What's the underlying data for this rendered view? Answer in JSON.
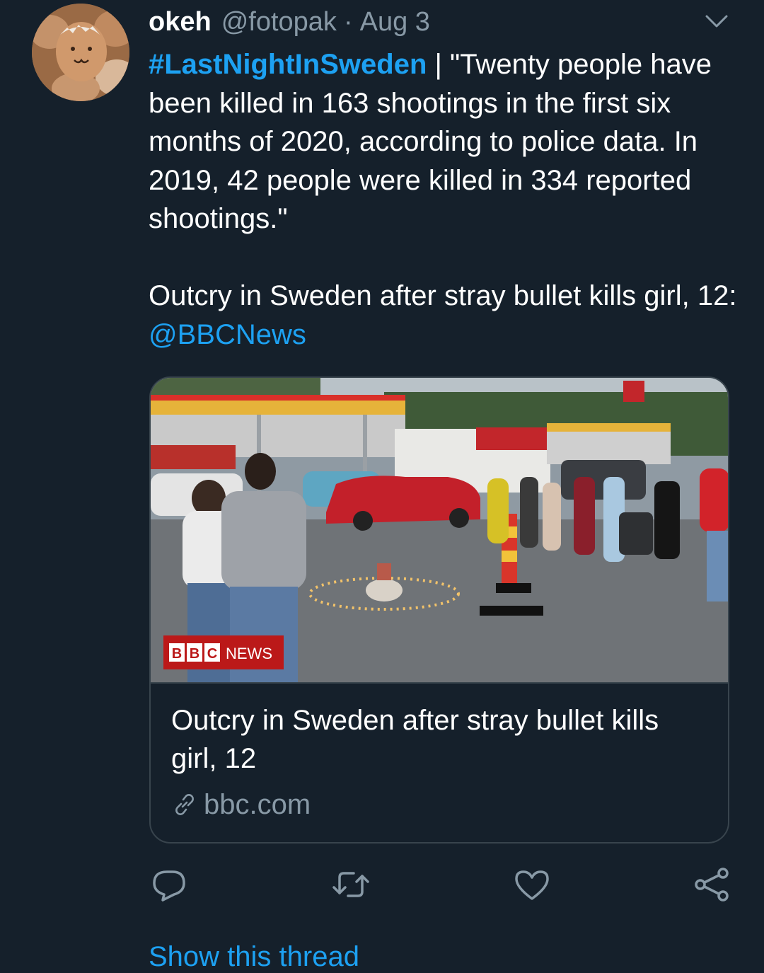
{
  "tweet": {
    "display_name": "okeh",
    "handle": "@fotopak",
    "separator": "·",
    "date": "Aug 3",
    "hashtag": "#LastNightInSweden",
    "text_part1": " | \"Twenty people have been killed in 163 shootings in the first six months of 2020, according to police data. In 2019, 42 people were killed in 334 reported shootings.\"",
    "text_part2": "Outcry in Sweden after stray bullet kills girl, 12: ",
    "mention": "@BBCNews"
  },
  "card": {
    "image_icon": "bbc-news-photo",
    "badge_bbc_letters": [
      "B",
      "B",
      "C"
    ],
    "badge_news": "NEWS",
    "title": "Outcry in Sweden after stray bullet kills girl, 12",
    "domain": "bbc.com",
    "domain_icon": "link-icon"
  },
  "actions": {
    "reply_icon": "reply-icon",
    "retweet_icon": "retweet-icon",
    "like_icon": "like-icon",
    "share_icon": "share-icon"
  },
  "show_thread": "Show this thread",
  "colors": {
    "background": "#15202b",
    "text": "#ffffff",
    "secondary": "#8899a6",
    "accent": "#1da1f2",
    "border": "#38444d",
    "bbc_red": "#bb1919"
  }
}
